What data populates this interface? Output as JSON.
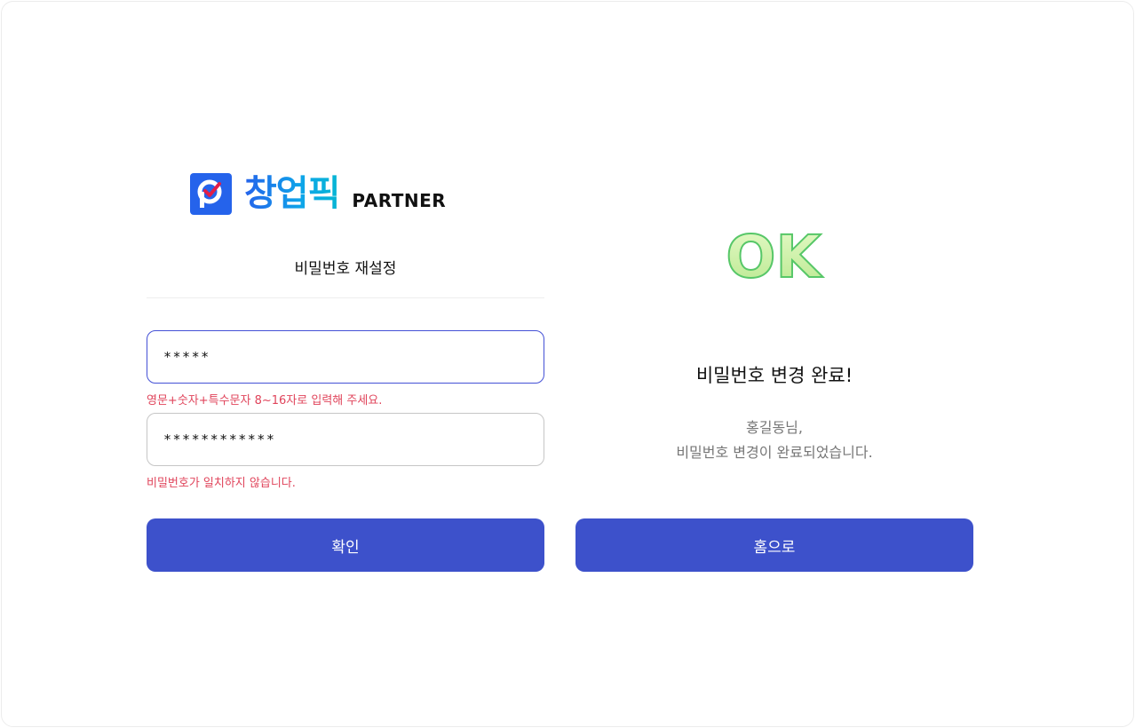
{
  "logo": {
    "brand_text": "창업픽",
    "partner_text": "PARTNER"
  },
  "form": {
    "title": "비밀번호 재설정",
    "password_value": "*****",
    "password_error": "영문+숫자+특수문자 8~16자로 입력해 주세요.",
    "confirm_value": "************",
    "confirm_error": "비밀번호가 일치하지 않습니다.",
    "confirm_button": "확인"
  },
  "result": {
    "badge_text": "OK",
    "title": "비밀번호 변경 완료!",
    "message_line1": "홍길동님,",
    "message_line2": "비밀번호 변경이 완료되었습니다.",
    "home_button": "홈으로"
  },
  "colors": {
    "brand_blue": "#2563eb",
    "button": "#3d51cb",
    "error": "#e0445b",
    "ok_fill": "#c7ef9f",
    "ok_stroke": "#57c768"
  },
  "icons": {
    "logo_mark": "p-check-logo-icon",
    "ok_badge": "ok-success-icon"
  }
}
